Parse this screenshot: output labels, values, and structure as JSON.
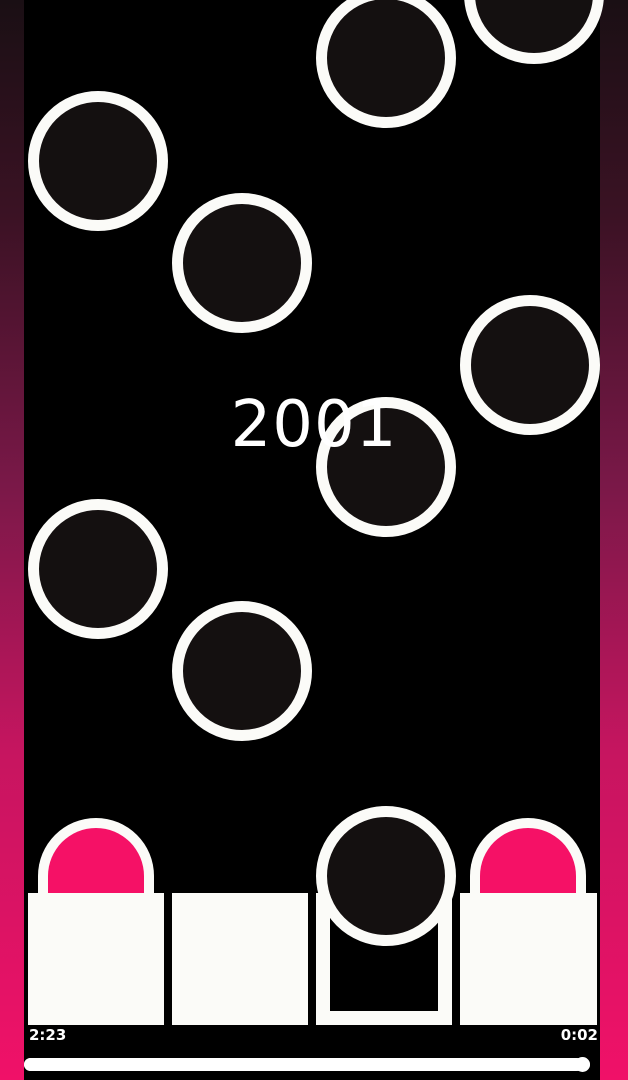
{
  "score": "2001",
  "time": {
    "elapsed": "2:23",
    "remaining": "0:02"
  },
  "progress": {
    "fraction": 0.985
  },
  "lanes": [
    {
      "index": 1,
      "state": "pressed",
      "dome_color": "#f51166"
    },
    {
      "index": 2,
      "state": "idle"
    },
    {
      "index": 3,
      "state": "hollow"
    },
    {
      "index": 4,
      "state": "pressed",
      "dome_color": "#f51166"
    }
  ],
  "colors": {
    "accent": "#f51166",
    "note_fill": "#141010",
    "note_ring": "#fbfbf8",
    "background": "#000000"
  }
}
